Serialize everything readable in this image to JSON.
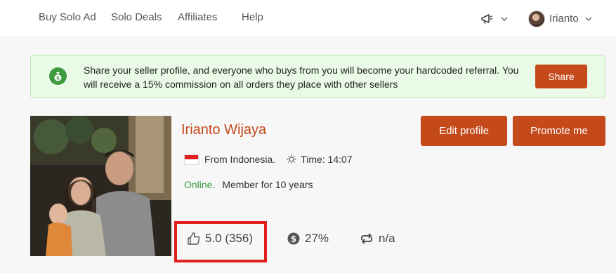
{
  "nav": {
    "links": [
      "Buy Solo Ad",
      "Solo Deals",
      "Affiliates",
      "Help"
    ],
    "icons": [
      "megaphone-icon",
      "chevron-down-icon"
    ],
    "user": {
      "name": "Irianto"
    }
  },
  "banner": {
    "text": "Share your seller profile, and everyone who buys from you will become your hardcoded referral. You will receive a 15% commission on all orders they place with other sellers",
    "share_label": "Share",
    "accent": "#3e9a3e",
    "background": "#e9fae6"
  },
  "profile": {
    "name": "Irianto Wijaya",
    "country": "From Indonesia.",
    "time": "Time: 14:07",
    "status": "Online.",
    "member": "Member for 10 years",
    "edit_label": "Edit profile",
    "promote_label": "Promote me"
  },
  "stats": {
    "rating": "5.0 (356)",
    "percent": "27%",
    "repeat": "n/a"
  },
  "colors": {
    "brand": "#c4491b",
    "highlight": "#e0201b"
  }
}
